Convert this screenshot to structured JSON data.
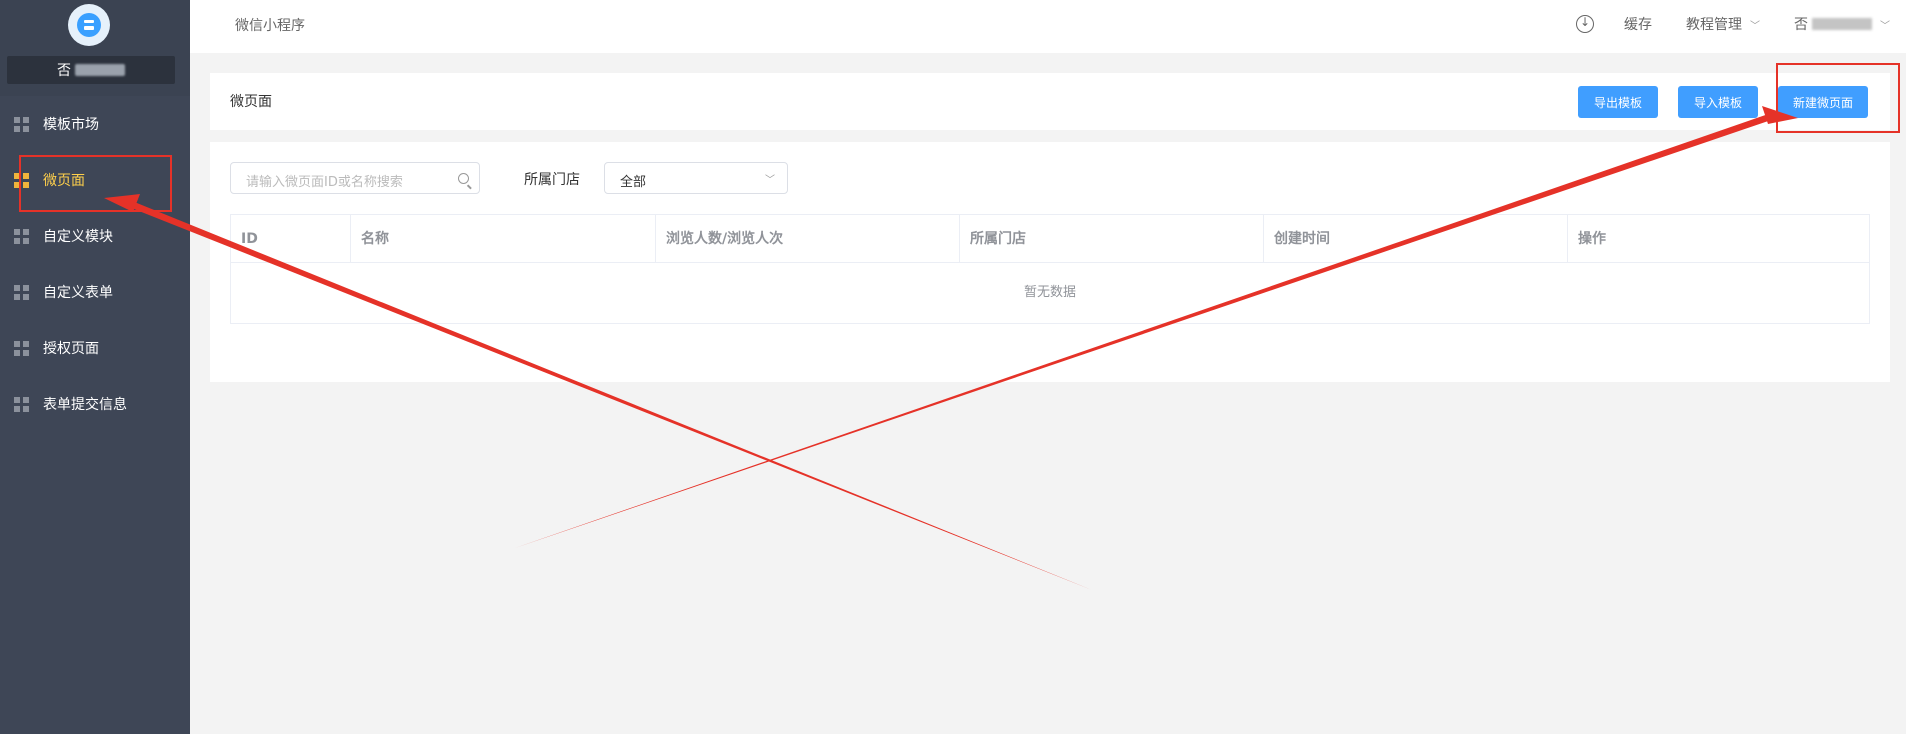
{
  "sidebar": {
    "shop_name": "否",
    "items": [
      {
        "label": "模板市场",
        "active": false
      },
      {
        "label": "微页面",
        "active": true
      },
      {
        "label": "自定义模块",
        "active": false
      },
      {
        "label": "自定义表单",
        "active": false
      },
      {
        "label": "授权页面",
        "active": false
      },
      {
        "label": "表单提交信息",
        "active": false
      }
    ]
  },
  "topbar": {
    "breadcrumb": "微信小程序",
    "cache_label": "缓存",
    "tutorial_label": "教程管理",
    "user_prefix": "否"
  },
  "header": {
    "title": "微页面",
    "export_label": "导出模板",
    "import_label": "导入模板",
    "new_label": "新建微页面"
  },
  "filters": {
    "search_placeholder": "请输入微页面ID或名称搜索",
    "store_label": "所属门店",
    "store_value": "全部"
  },
  "table": {
    "columns": [
      "ID",
      "名称",
      "浏览人数/浏览人次",
      "所属门店",
      "创建时间",
      "操作"
    ],
    "empty_text": "暂无数据"
  },
  "colors": {
    "primary": "#409eff",
    "sidebar_bg": "#3e4656",
    "active_menu": "#ffd04b",
    "annotation": "#e53228"
  }
}
